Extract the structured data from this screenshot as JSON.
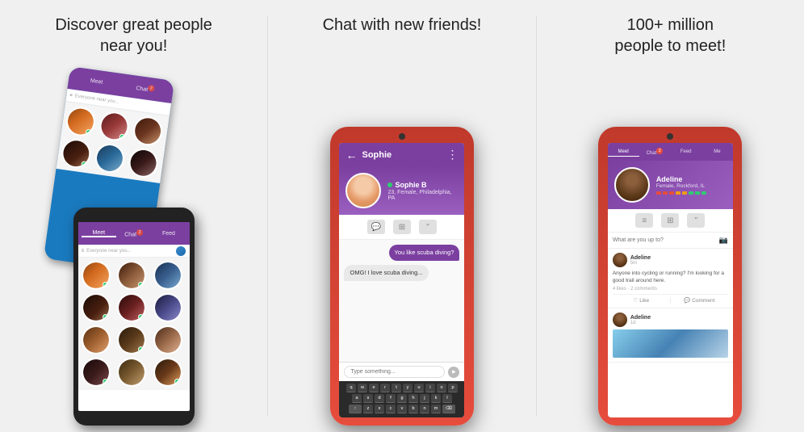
{
  "panels": [
    {
      "id": "discover",
      "title": "Discover great people\nnear you!",
      "filter_label": "Everyone near you..."
    },
    {
      "id": "chat",
      "title": "Chat with new friends!"
    },
    {
      "id": "meet",
      "title": "100+ million\npeople to meet!"
    }
  ],
  "app_tabs": [
    "Meet",
    "Chat",
    "Feed",
    "Me"
  ],
  "chat": {
    "contact_name": "Sophie",
    "profile_name": "Sophie B",
    "profile_sub": "23, Female, Philadelphia, PA",
    "messages": [
      {
        "type": "sent",
        "text": "You like scuba diving?"
      },
      {
        "type": "received",
        "text": "OMG! I love scuba diving..."
      }
    ],
    "input_placeholder": "Type something...",
    "keyboard_rows": [
      [
        "q",
        "w",
        "e",
        "r",
        "t",
        "y",
        "u",
        "i",
        "o",
        "p"
      ],
      [
        "a",
        "s",
        "d",
        "f",
        "g",
        "h",
        "j",
        "k",
        "l"
      ],
      [
        "↑",
        "z",
        "x",
        "c",
        "v",
        "b",
        "n",
        "m",
        "⌫"
      ]
    ]
  },
  "profile": {
    "name": "Adeline",
    "sub": "Female, Rockford, IL",
    "feed_search_placeholder": "What are you up to?",
    "posts": [
      {
        "author": "Adeline",
        "time": "5m",
        "text": "Anyone into cycling or running? I'm looking for a good trail around here.",
        "likes": "4 likes",
        "comments": "2 comments",
        "actions": [
          "Like",
          "Comment"
        ]
      },
      {
        "author": "Adeline",
        "time": "1d",
        "has_image": true
      }
    ]
  },
  "compat_colors": [
    "#e74c3c",
    "#e74c3c",
    "#e74c3c",
    "#f39c12",
    "#f39c12",
    "#2ecc71",
    "#2ecc71",
    "#2ecc71"
  ],
  "accent_color": "#7b3fa0",
  "online_color": "#2ecc71",
  "badge_color": "#e74c3c"
}
